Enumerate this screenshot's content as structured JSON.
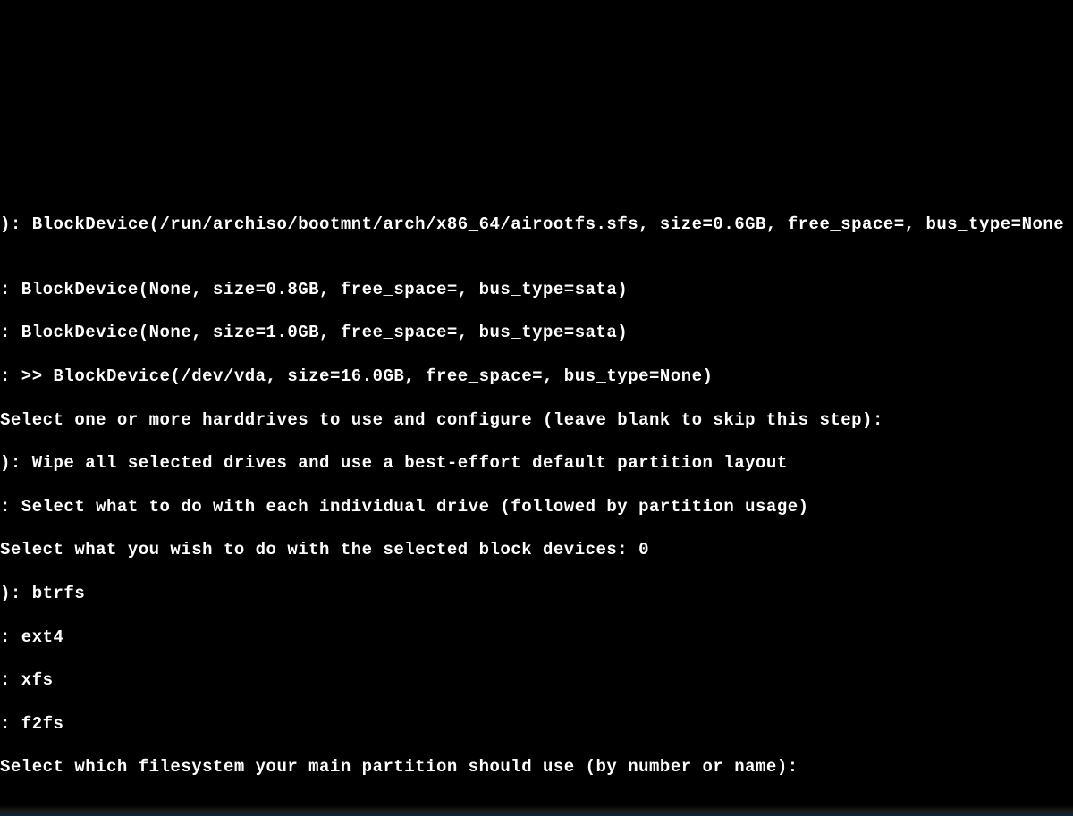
{
  "terminal": {
    "lines": [
      "): BlockDevice(/run/archiso/bootmnt/arch/x86_64/airootfs.sfs, size=0.6GB, free_space=, bus_type=None",
      "",
      ": BlockDevice(None, size=0.8GB, free_space=, bus_type=sata)",
      ": BlockDevice(None, size=1.0GB, free_space=, bus_type=sata)",
      ": >> BlockDevice(/dev/vda, size=16.0GB, free_space=, bus_type=None)",
      "Select one or more harddrives to use and configure (leave blank to skip this step):",
      "): Wipe all selected drives and use a best-effort default partition layout",
      ": Select what to do with each individual drive (followed by partition usage)",
      "Select what you wish to do with the selected block devices: 0",
      "): btrfs",
      ": ext4",
      ": xfs",
      ": f2fs",
      "Select which filesystem your main partition should use (by number or name):"
    ]
  }
}
